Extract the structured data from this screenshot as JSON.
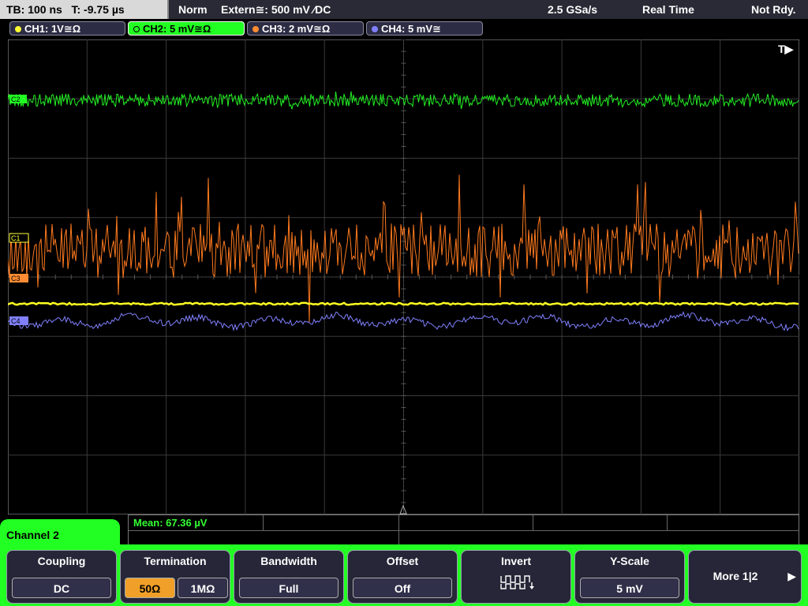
{
  "topbar": {
    "timebase": "TB: 100 ns",
    "trigger_time": "T: -9.75 µs",
    "mode": "Norm",
    "trigger_source": "Extern≅: 500 mV ⁄DC",
    "sample_rate": "2.5 GSa/s",
    "acq_mode": "Real Time",
    "status": "Not Rdy."
  },
  "channels": [
    {
      "label": "CH1: 1V≅Ω",
      "color": "#ffff33"
    },
    {
      "label": "CH2: 5 mV≅Ω",
      "color": "#22ff22"
    },
    {
      "label": "CH3: 2 mV≅Ω",
      "color": "#ff8c33"
    },
    {
      "label": "CH4: 5 mV≅",
      "color": "#8080ff"
    }
  ],
  "screen": {
    "trigger_marker": "T▶",
    "ch_markers": {
      "c1": "C1",
      "c2": "C2",
      "c3": "C3",
      "c4": "C4"
    }
  },
  "measurement": {
    "text": "Mean: 67.36 µV"
  },
  "menu": {
    "title": "Channel 2"
  },
  "softkeys": {
    "coupling": {
      "label": "Coupling",
      "value": "DC"
    },
    "termination": {
      "label": "Termination",
      "opt1": "50Ω",
      "opt2": "1MΩ"
    },
    "bandwidth": {
      "label": "Bandwidth",
      "value": "Full"
    },
    "offset": {
      "label": "Offset",
      "value": "Off"
    },
    "invert": {
      "label": "Invert"
    },
    "yscale": {
      "label": "Y-Scale",
      "value": "5 mV"
    },
    "more": {
      "label": "More 1|2",
      "arrow": "▶"
    }
  }
}
